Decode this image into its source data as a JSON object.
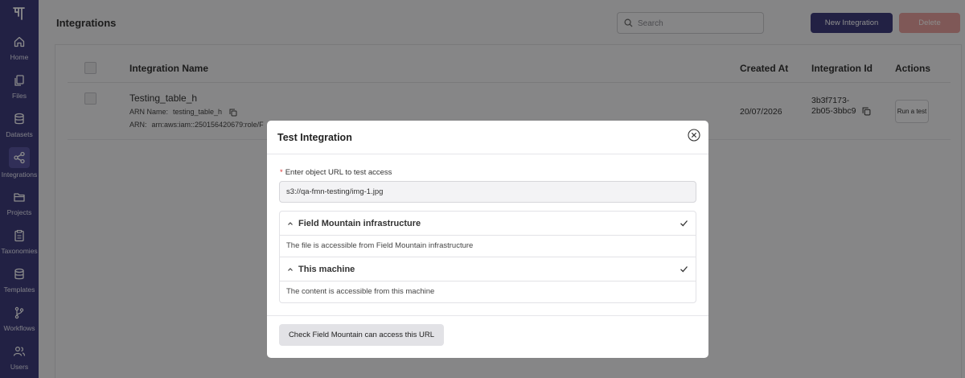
{
  "sidebar": {
    "items": [
      {
        "label": "Home",
        "icon": "home-icon"
      },
      {
        "label": "Files",
        "icon": "files-icon"
      },
      {
        "label": "Datasets",
        "icon": "database-icon"
      },
      {
        "label": "Integrations",
        "icon": "share-icon",
        "active": true
      },
      {
        "label": "Projects",
        "icon": "folder-icon"
      },
      {
        "label": "Taxonomies",
        "icon": "clipboard-icon"
      },
      {
        "label": "Templates",
        "icon": "database-icon"
      },
      {
        "label": "Workflows",
        "icon": "branch-icon"
      },
      {
        "label": "Users",
        "icon": "users-icon"
      }
    ]
  },
  "header": {
    "title": "Integrations",
    "search_placeholder": "Search",
    "new_label": "New Integration",
    "delete_label": "Delete"
  },
  "table": {
    "columns": [
      "Integration Name",
      "Created At",
      "Integration Id",
      "Actions"
    ],
    "rows": [
      {
        "name": "Testing_table_h",
        "arn_name_label": "ARN Name:",
        "arn_name": "testing_table_h",
        "arn_label": "ARN:",
        "arn": "arn:aws:iam::250156420679:role/F",
        "created_at": "20/07/2026",
        "integration_id": "3b3f7173-2b05-3bbc9",
        "action_label": "Run a test"
      }
    ]
  },
  "modal": {
    "title": "Test Integration",
    "field_label": "Enter object URL to test access",
    "required_marker": "*",
    "url_value": "s3://qa-fmn-testing/img-1.jpg",
    "results": [
      {
        "title": "Field Mountain infrastructure",
        "message": "The file is accessible from Field Mountain infrastructure",
        "status": "success"
      },
      {
        "title": "This machine",
        "message": "The content is accessible from this machine",
        "status": "success"
      }
    ],
    "check_button": "Check Field Mountain can access this URL"
  },
  "colors": {
    "sidebar": "#3f3c7d",
    "primary_button": "#3f3c7d",
    "delete_button": "#e7a19e",
    "page_bg": "#f2f2f4"
  }
}
